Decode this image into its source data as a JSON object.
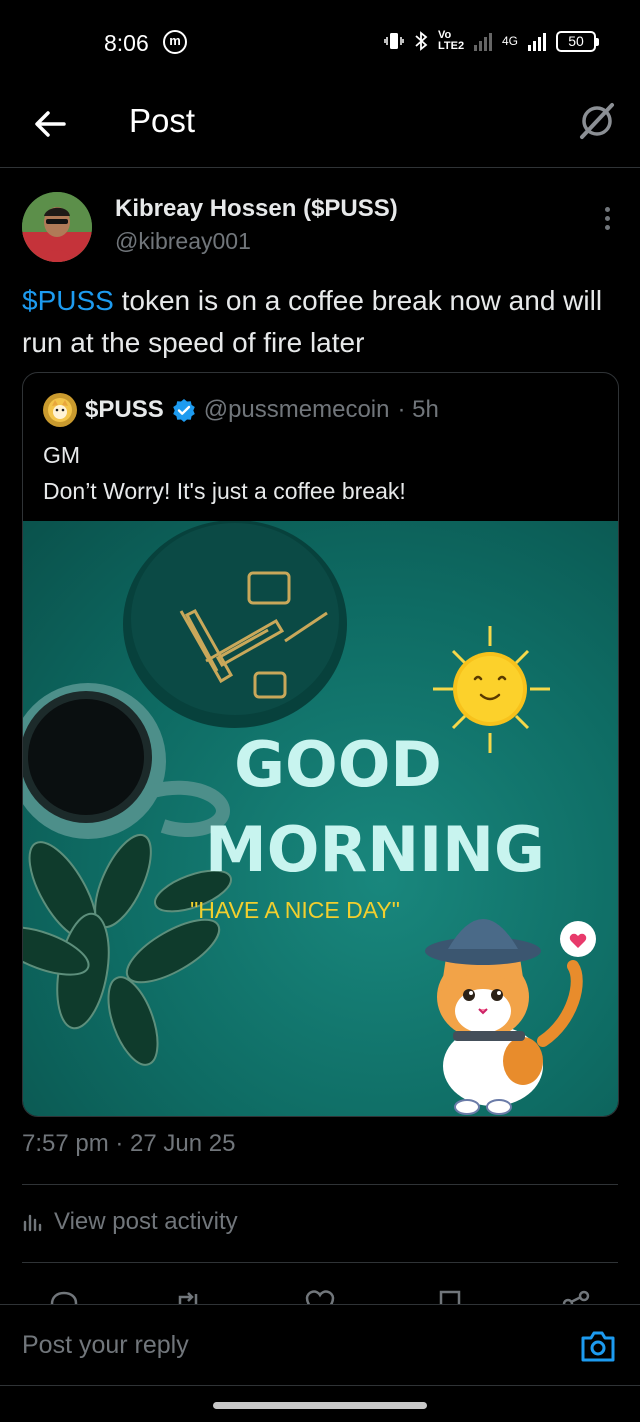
{
  "status_bar": {
    "time": "8:06",
    "network": "Vo LTE2",
    "network_type": "4G",
    "battery": "50"
  },
  "header": {
    "title": "Post"
  },
  "post": {
    "author_name": "Kibreay Hossen ($PUSS)",
    "author_handle": "@kibreay001",
    "cashtag": "$PUSS",
    "text_rest": " token is on a coffee break now and will run at the speed of fire later",
    "timestamp": "7:57 pm · 27 Jun 25",
    "activity_label": "View post activity"
  },
  "quote": {
    "name": "$PUSS",
    "handle": "@pussmemecoin",
    "time": "· 5h",
    "line1": "GM",
    "line2": "Don’t Worry! It's just a coffee break!",
    "image_text": {
      "line1": "GOOD",
      "line2": "MORNING",
      "tagline": "\"HAVE A NICE DAY\""
    }
  },
  "reply": {
    "placeholder": "Post your reply"
  },
  "colors": {
    "accent": "#1d9bf0",
    "muted": "#71767b",
    "background": "#000000",
    "media_bg": "#0e6b63"
  }
}
